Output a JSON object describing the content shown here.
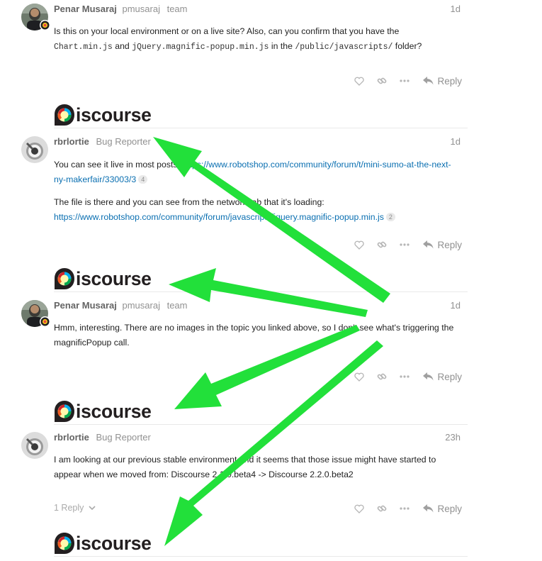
{
  "posts": [
    {
      "full_name": "Penar Musaraj",
      "username": "pmusaraj",
      "user_title": "team",
      "date": "1d",
      "paragraphs": [
        {
          "segments": [
            {
              "text": "Is this on your local environment or on a live site? Also, can you confirm that you have the "
            },
            {
              "code": "Chart.min.js"
            },
            {
              "text": " and "
            },
            {
              "code": "jQuery.magnific-popup.min.js"
            },
            {
              "text": " in the "
            },
            {
              "code": "/public/javascripts/"
            },
            {
              "text": " folder?"
            }
          ]
        }
      ],
      "reply_label": "Reply",
      "logo_text": "iscourse"
    },
    {
      "full_name": "rbrlortie",
      "username": "",
      "user_title": "Bug Reporter",
      "date": "1d",
      "paragraphs": [
        {
          "segments": [
            {
              "text": "You can see it live in most posts. "
            },
            {
              "link": "https://www.robotshop.com/community/forum/t/mini-sumo-at-the-next-ny-makerfair/33003/3"
            },
            {
              "clicks": "4"
            }
          ]
        },
        {
          "segments": [
            {
              "text": "The file is there and you can see from the network tab that it's loading: "
            },
            {
              "link": "https://www.robotshop.com/community/forum/javascripts/jquery.magnific-popup.min.js"
            },
            {
              "clicks": "2"
            }
          ]
        }
      ],
      "reply_label": "Reply",
      "logo_text": "iscourse"
    },
    {
      "full_name": "Penar Musaraj",
      "username": "pmusaraj",
      "user_title": "team",
      "date": "1d",
      "paragraphs": [
        {
          "segments": [
            {
              "text": "Hmm, interesting. There are no images in the topic you linked above, so I don't see what's triggering the magnificPopup call."
            }
          ]
        }
      ],
      "reply_label": "Reply",
      "logo_text": "iscourse"
    },
    {
      "full_name": "rbrlortie",
      "username": "",
      "user_title": "Bug Reporter",
      "date": "23h",
      "paragraphs": [
        {
          "segments": [
            {
              "text": "I am looking at our previous stable environment and it seems that those issue might have started to appear when we moved from: Discourse 2.1.0.beta4 -> Discourse 2.2.0.beta2"
            }
          ]
        }
      ],
      "replies_toggle": "1 Reply",
      "reply_label": "Reply",
      "logo_text": "iscourse"
    }
  ],
  "colors": {
    "link": "#0a6fb1",
    "muted": "#919191",
    "annotation_arrow": "#22e03a"
  },
  "icons": [
    "heart-icon",
    "link-icon",
    "more-icon",
    "reply-arrow-icon",
    "chevron-down-icon"
  ]
}
